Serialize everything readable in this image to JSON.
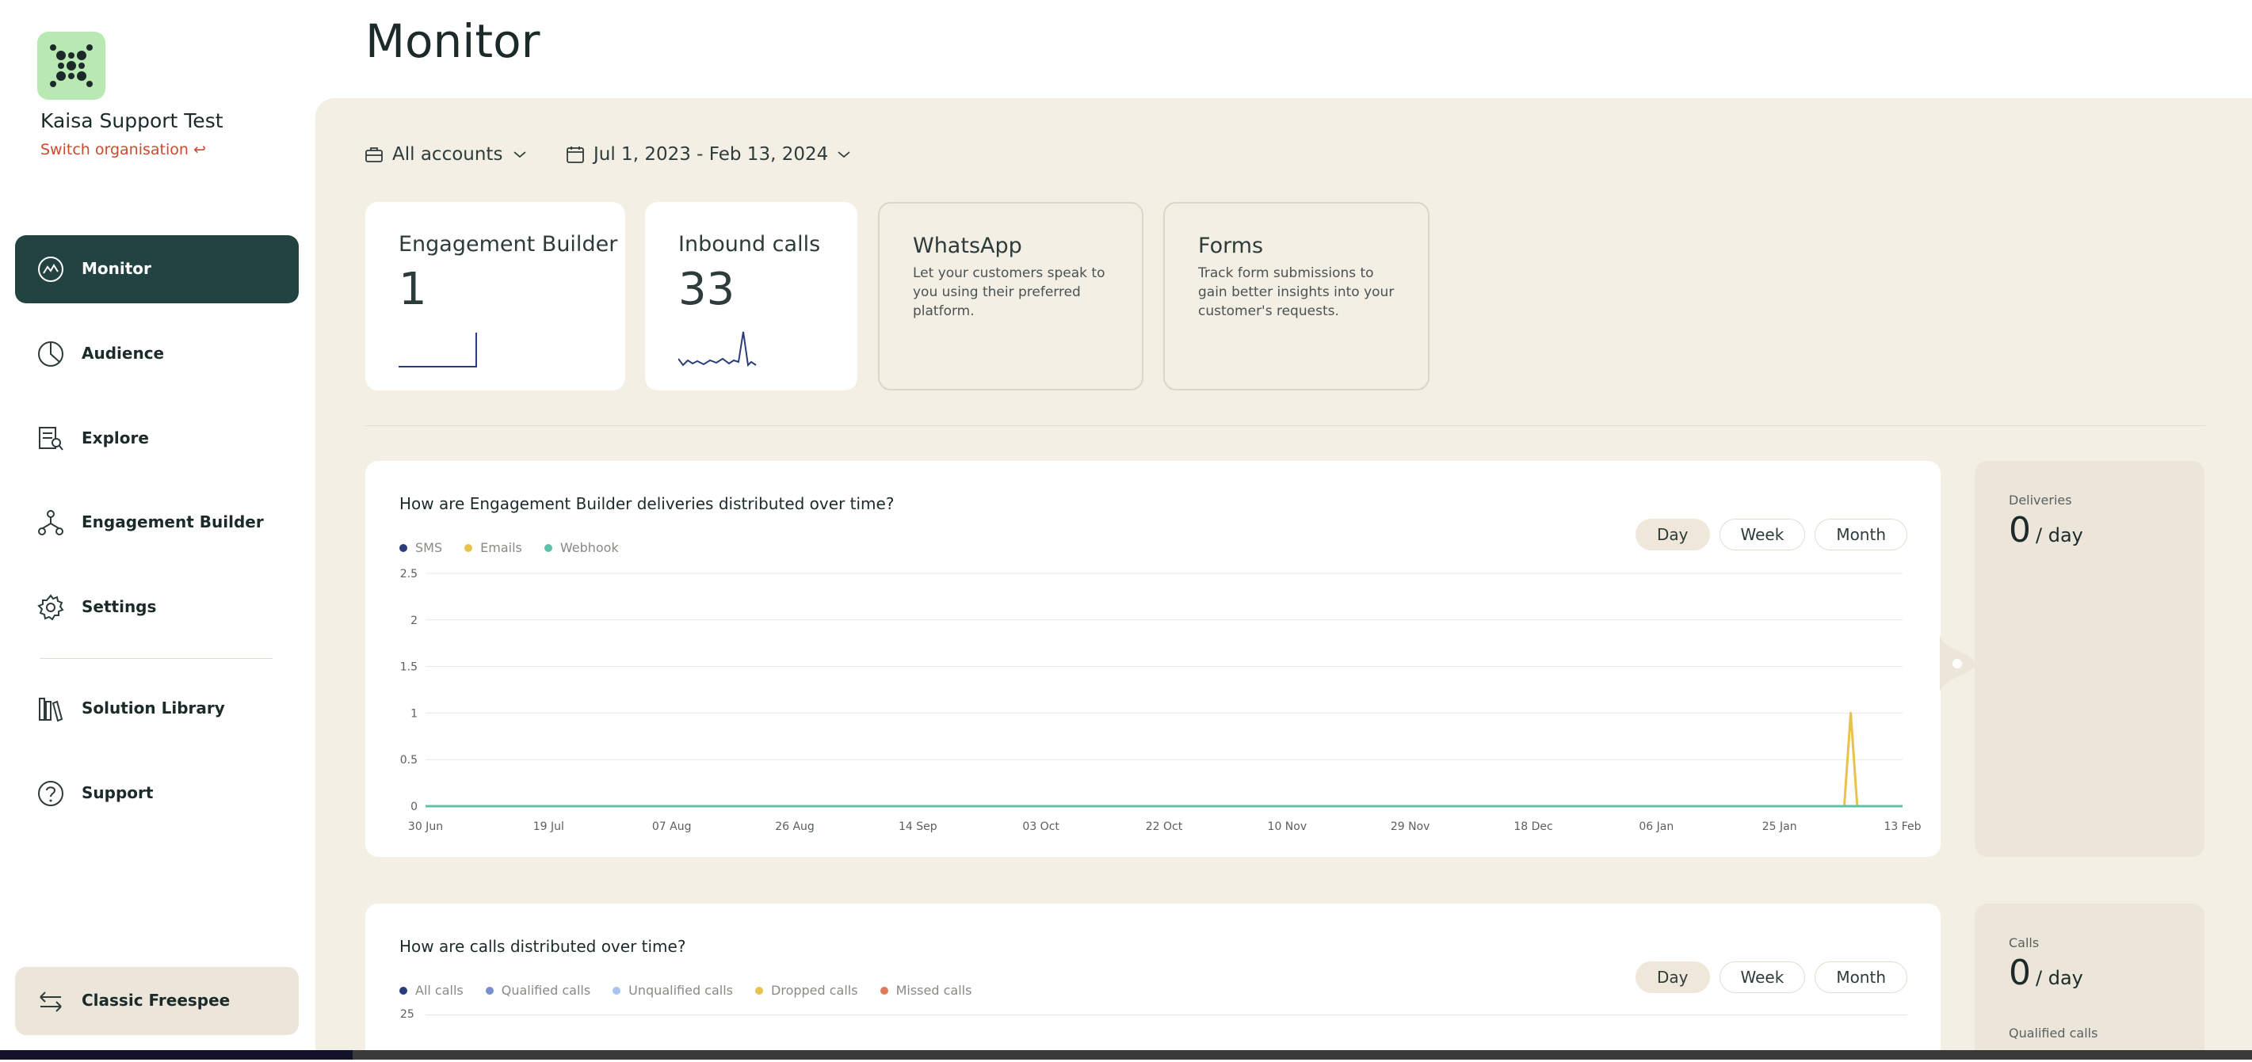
{
  "app": {
    "org_name": "Kaisa Support Test",
    "switch_org": "Switch organisation ↩",
    "page_title": "Monitor"
  },
  "nav": {
    "items": [
      {
        "label": "Monitor",
        "icon": "monitor-icon",
        "active": true
      },
      {
        "label": "Audience",
        "icon": "pie-chart-icon",
        "active": false
      },
      {
        "label": "Explore",
        "icon": "explore-icon",
        "active": false
      },
      {
        "label": "Engagement Builder",
        "icon": "flow-icon",
        "active": false
      },
      {
        "label": "Settings",
        "icon": "gear-icon",
        "active": false
      },
      {
        "label": "Solution Library",
        "icon": "library-icon",
        "active": false
      },
      {
        "label": "Support",
        "icon": "help-icon",
        "active": false
      }
    ],
    "classic": "Classic Freespee"
  },
  "filters": {
    "accounts": "All accounts",
    "date_range": "Jul 1, 2023 - Feb 13, 2024"
  },
  "cards": [
    {
      "title": "Engagement Builder",
      "value": "1"
    },
    {
      "title": "Inbound calls",
      "value": "33"
    },
    {
      "title": "WhatsApp",
      "desc": "Let your customers speak to you using their preferred platform."
    },
    {
      "title": "Forms",
      "desc": "Track form submissions to gain better insights into your customer's requests."
    }
  ],
  "panel1": {
    "title": "How are Engagement Builder deliveries distributed over time?",
    "legend": [
      "SMS",
      "Emails",
      "Webhook"
    ],
    "seg": [
      "Day",
      "Week",
      "Month"
    ],
    "stat_label": "Deliveries",
    "stat_value": "0",
    "stat_unit": "/ day"
  },
  "panel2": {
    "title": "How are calls distributed over time?",
    "legend": [
      "All calls",
      "Qualified calls",
      "Unqualified calls",
      "Dropped calls",
      "Missed calls"
    ],
    "seg": [
      "Day",
      "Week",
      "Month"
    ],
    "stat_label": "Calls",
    "stat_value": "0",
    "stat_unit": "/ day",
    "stat_label2": "Qualified calls",
    "y_top": "25"
  },
  "colors": {
    "sms": "#2c3c7a",
    "emails": "#e8c24a",
    "webhook": "#5cc2a8",
    "all_calls": "#2c3c7a",
    "qualified": "#7a8fd0",
    "unqualified": "#a8c4ec",
    "dropped": "#e8c24a",
    "missed": "#e07a5a"
  },
  "chart_data": {
    "type": "line",
    "title": "How are Engagement Builder deliveries distributed over time?",
    "x_tick_labels": [
      "30 Jun",
      "19 Jul",
      "07 Aug",
      "26 Aug",
      "14 Sep",
      "03 Oct",
      "22 Oct",
      "10 Nov",
      "29 Nov",
      "18 Dec",
      "06 Jan",
      "25 Jan",
      "13 Feb"
    ],
    "y_tick_labels": [
      "0",
      "0.5",
      "1",
      "1.5",
      "2",
      "2.5"
    ],
    "ylim": [
      0,
      2.5
    ],
    "xlim": [
      "2023-06-30",
      "2024-02-13"
    ],
    "grid": true,
    "legend_position": "top-left",
    "series": [
      {
        "name": "SMS",
        "color": "#2c3c7a",
        "points": [
          [
            "2023-06-30",
            0
          ],
          [
            "2024-02-13",
            0
          ]
        ]
      },
      {
        "name": "Emails",
        "color": "#e8c24a",
        "points": [
          [
            "2023-06-30",
            0
          ],
          [
            "2024-02-04",
            0
          ],
          [
            "2024-02-05",
            1
          ],
          [
            "2024-02-06",
            0
          ],
          [
            "2024-02-13",
            0
          ]
        ]
      },
      {
        "name": "Webhook",
        "color": "#5cc2a8",
        "points": [
          [
            "2023-06-30",
            0
          ],
          [
            "2024-02-13",
            0
          ]
        ]
      }
    ]
  }
}
